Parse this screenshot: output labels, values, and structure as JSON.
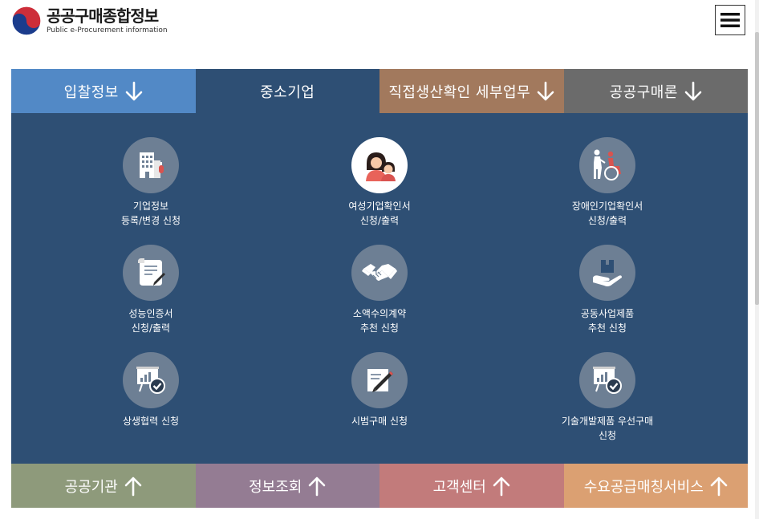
{
  "header": {
    "title_ko": "공공구매종합정보",
    "title_en": "Public e-Procurement information",
    "menu_icon": "hamburger-icon"
  },
  "tabs": [
    {
      "label": "입찰정보",
      "icon": "arrow-down-icon"
    },
    {
      "label": "중소기업",
      "icon": ""
    },
    {
      "label": "직접생산확인 세부업무",
      "icon": "arrow-down-icon"
    },
    {
      "label": "공공구매론",
      "icon": "arrow-down-icon"
    }
  ],
  "services": [
    {
      "line1": "기업정보",
      "line2": "등록/변경 신청",
      "icon": "building-icon"
    },
    {
      "line1": "여성기업확인서",
      "line2": "신청/출력",
      "icon": "women-icon"
    },
    {
      "line1": "장애인기업확인서",
      "line2": "신청/출력",
      "icon": "wheelchair-icon"
    },
    {
      "line1": "성능인증서",
      "line2": "신청/출력",
      "icon": "certificate-icon"
    },
    {
      "line1": "소액수의계약",
      "line2": "추천 신청",
      "icon": "handshake-icon"
    },
    {
      "line1": "공동사업제품",
      "line2": "추천 신청",
      "icon": "product-hand-icon"
    },
    {
      "line1": "상생협력 신청",
      "line2": "",
      "icon": "chart-check-icon"
    },
    {
      "line1": "시범구매 신청",
      "line2": "",
      "icon": "edit-document-icon"
    },
    {
      "line1": "기술개발제품 우선구매",
      "line2": "신청",
      "icon": "chart-check-icon"
    }
  ],
  "bottom_tabs": [
    {
      "label": "공공기관",
      "icon": "arrow-up-icon"
    },
    {
      "label": "정보조회",
      "icon": "arrow-up-icon"
    },
    {
      "label": "고객센터",
      "icon": "arrow-up-icon"
    },
    {
      "label": "수요공급매칭서비스",
      "icon": "arrow-up-icon"
    }
  ],
  "colors": {
    "tab_bid": "#5289c6",
    "tab_sme": "#2e4f74",
    "tab_direct": "#a2795d",
    "tab_public": "#6b6b6b",
    "panel": "#2e4f74",
    "bottom_public": "#8e9a7b",
    "bottom_info": "#947c93",
    "bottom_customer": "#c27b7b",
    "bottom_matching": "#dba072"
  }
}
